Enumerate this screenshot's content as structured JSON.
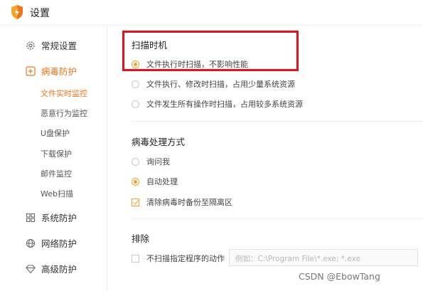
{
  "window": {
    "title": "设置"
  },
  "sidebar": {
    "items": [
      {
        "label": "常规设置",
        "icon": "gear-icon"
      },
      {
        "label": "病毒防护",
        "icon": "plus-square-icon"
      },
      {
        "label": "系统防护",
        "icon": "grid-icon"
      },
      {
        "label": "网络防护",
        "icon": "globe-icon"
      },
      {
        "label": "高级防护",
        "icon": "diamond-icon"
      }
    ],
    "subitems": [
      "文件实时监控",
      "恶意行为监控",
      "U盘保护",
      "下载保护",
      "邮件监控",
      "Web扫描"
    ]
  },
  "scan": {
    "title": "扫描时机",
    "options": [
      "文件执行时扫描，不影响性能",
      "文件执行、修改时扫描，占用少量系统资源",
      "文件发生所有操作时扫描，占用较多系统资源"
    ],
    "selected": 0
  },
  "handling": {
    "title": "病毒处理方式",
    "options": [
      "询问我",
      "自动处理"
    ],
    "selected": 1,
    "backup_label": "清除病毒时备份至隔离区",
    "backup_checked": true
  },
  "exclude": {
    "title": "排除",
    "checkbox_label": "不扫描指定程序的动作",
    "placeholder": "例如：C:\\Program File\\*.exe; *.exe"
  },
  "watermark": "CSDN @EbowTang",
  "colors": {
    "accent": "#f0751b",
    "radio": "#f0a030",
    "highlight": "#e0141c"
  }
}
